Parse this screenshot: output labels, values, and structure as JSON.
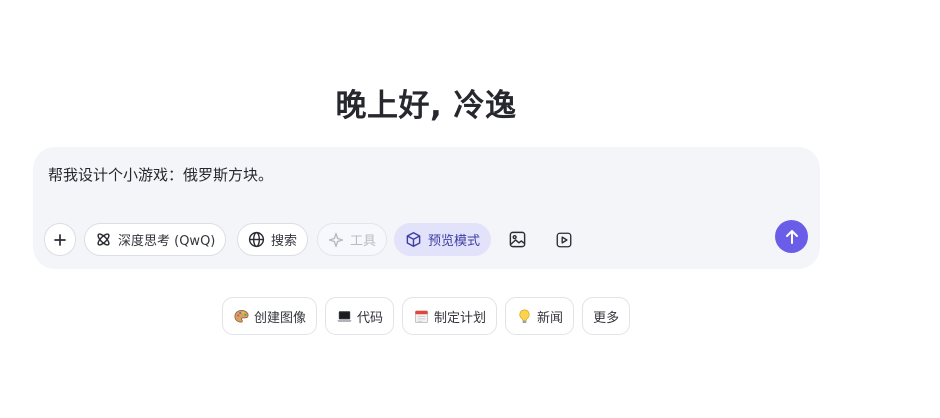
{
  "greeting": "晚上好, 冷逸",
  "composer": {
    "input_value": "帮我设计个小游戏：俄罗斯方块。",
    "add_label": "+",
    "chips": {
      "deep_think": "深度思考 (QwQ)",
      "search": "搜索",
      "tools": "工具",
      "preview": "预览模式"
    }
  },
  "suggestions": [
    {
      "label": "创建图像",
      "icon": "palette-icon"
    },
    {
      "label": "代码",
      "icon": "laptop-icon"
    },
    {
      "label": "制定计划",
      "icon": "calendar-icon"
    },
    {
      "label": "新闻",
      "icon": "lightbulb-icon"
    },
    {
      "label": "更多"
    }
  ],
  "colors": {
    "accent": "#6a5ee8",
    "preview_bg": "#e2e2fb",
    "composer_bg": "#f4f5f9"
  }
}
